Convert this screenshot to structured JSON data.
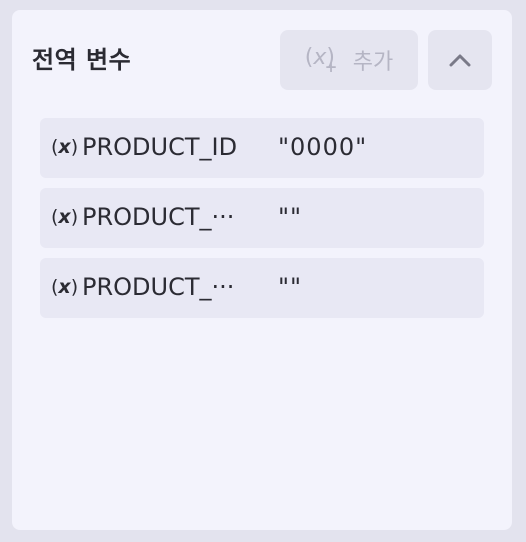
{
  "panel": {
    "title": "전역 변수",
    "add_button": {
      "icon": "variable-add-icon",
      "label": "추가",
      "disabled": true
    },
    "collapse_button": {
      "icon": "chevron-up-icon"
    }
  },
  "variables": [
    {
      "icon_text": "(x)",
      "name": "PRODUCT_ID",
      "value": "\"0000\""
    },
    {
      "icon_text": "(x)",
      "name": "PRODUCT_···",
      "value": "\"\""
    },
    {
      "icon_text": "(x)",
      "name": "PRODUCT_···",
      "value": "\"\""
    }
  ],
  "colors": {
    "background": "#e3e3ee",
    "panel": "#f3f3fc",
    "row": "#e8e8f4",
    "button": "#e5e5f0",
    "text": "#2b2b33",
    "disabled_text": "#b5b5c4"
  }
}
